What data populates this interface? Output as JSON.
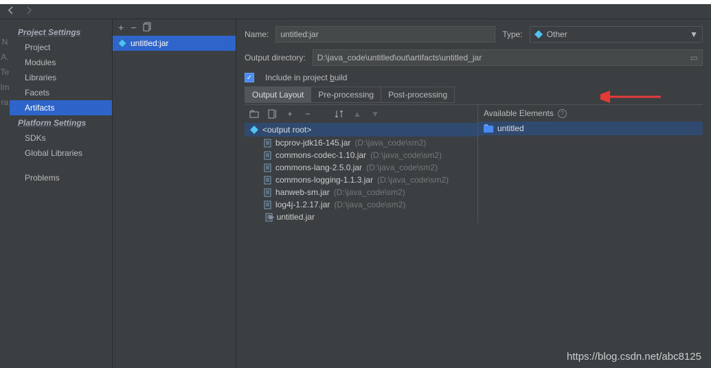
{
  "sidebar": {
    "heading1": "Project Settings",
    "items1": [
      "Project",
      "Modules",
      "Libraries",
      "Facets",
      "Artifacts"
    ],
    "heading2": "Platform Settings",
    "items2": [
      "SDKs",
      "Global Libraries"
    ],
    "problems": "Problems"
  },
  "mid": {
    "artifact": "untitled:jar"
  },
  "form": {
    "name_lbl": "Name:",
    "name_val": "untitled:jar",
    "type_lbl": "Type:",
    "type_val": "Other",
    "dir_lbl": "Output directory:",
    "dir_val": "D:\\java_code\\untitled\\out\\artifacts\\untitled_jar",
    "include_pre": "Include in project ",
    "include_b": "b",
    "include_post": "uild"
  },
  "tabs": [
    "Output Layout",
    "Pre-processing",
    "Post-processing"
  ],
  "tree": {
    "root": "<output root>",
    "items": [
      {
        "name": "bcprov-jdk16-145.jar",
        "path": "(D:\\java_code\\sm2)"
      },
      {
        "name": "commons-codec-1.10.jar",
        "path": "(D:\\java_code\\sm2)"
      },
      {
        "name": "commons-lang-2.5.0.jar",
        "path": "(D:\\java_code\\sm2)"
      },
      {
        "name": "commons-logging-1.1.3.jar",
        "path": "(D:\\java_code\\sm2)"
      },
      {
        "name": "hanweb-sm.jar",
        "path": "(D:\\java_code\\sm2)"
      },
      {
        "name": "log4j-1.2.17.jar",
        "path": "(D:\\java_code\\sm2)"
      },
      {
        "name": "untitled.jar",
        "path": ""
      }
    ]
  },
  "avail": {
    "label": "Available Elements",
    "item": "untitled"
  },
  "watermark": "https://blog.csdn.net/abc8125"
}
